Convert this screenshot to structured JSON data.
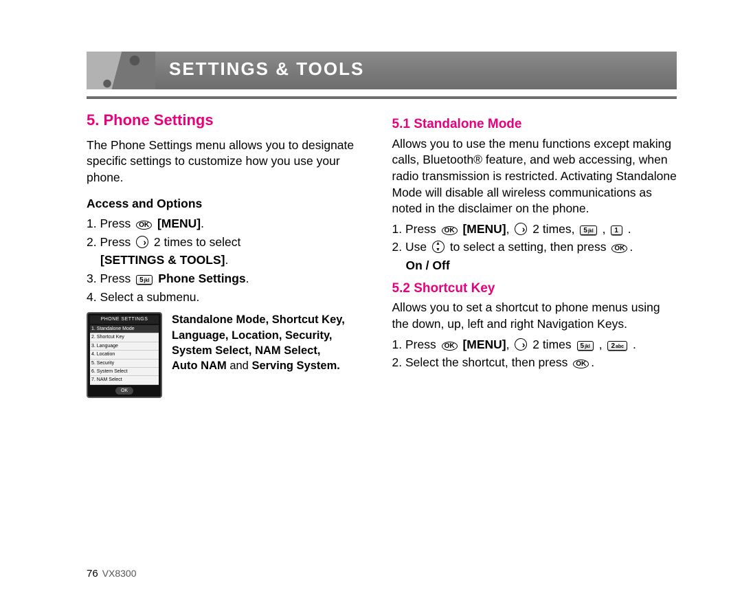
{
  "header": {
    "title": "SETTINGS & TOOLS"
  },
  "left": {
    "h_main": "5. Phone Settings",
    "intro": "The Phone Settings menu allows you to designate specific settings to customize how you use your phone.",
    "access_heading": "Access and Options",
    "step1_a": "1. Press ",
    "step1_b": "[MENU]",
    "step1_c": ".",
    "step2_a": "2. Press ",
    "step2_b": " 2 times to select",
    "step2_c": "[SETTINGS & TOOLS]",
    "step2_d": ".",
    "step3_a": "3. Press ",
    "step3_b": " Phone Settings",
    "step3_c": ".",
    "step4": "4. Select a submenu.",
    "screen": {
      "title": "PHONE SETTINGS",
      "items": [
        "1. Standalone Mode",
        "2. Shortcut Key",
        "3. Language",
        "4. Location",
        "5. Security",
        "6. System Select",
        "7. NAM Select"
      ],
      "softkey": "OK"
    },
    "submenu_lines": [
      "Standalone Mode, Shortcut Key,",
      "Language, Location, Security,",
      "System Select, NAM Select,",
      "Auto NAM ",
      "and ",
      "Serving System."
    ]
  },
  "right": {
    "h51": "5.1 Standalone Mode",
    "p51": "Allows you to use the menu functions except making calls, Bluetooth® feature, and web accessing, when radio transmission is restricted. Activating Standalone Mode will disable all wireless communications as noted in the disclaimer on the phone.",
    "s51_1a": "1. Press ",
    "s51_1b": "[MENU]",
    "s51_1c": ", ",
    "s51_1d": " 2 times, ",
    "s51_1e": " , ",
    "s51_1f": " .",
    "s51_2a": "2. Use ",
    "s51_2b": " to select a setting, then press ",
    "s51_2c": ".",
    "onoff": "On / Off",
    "h52": "5.2 Shortcut Key",
    "p52": "Allows you to set a shortcut to phone menus using the down, up, left and right Navigation Keys.",
    "s52_1a": "1. Press ",
    "s52_1b": "[MENU]",
    "s52_1c": ", ",
    "s52_1d": " 2 times ",
    "s52_1e": " , ",
    "s52_1f": " .",
    "s52_2a": "2. Select the shortcut, then press ",
    "s52_2b": "."
  },
  "keys": {
    "ok": "OK",
    "k5": "5",
    "k5s": "jkl",
    "k1": "1",
    "k1s": "",
    "k2": "2",
    "k2s": "abc"
  },
  "footer": {
    "page": "76",
    "model": "VX8300"
  }
}
